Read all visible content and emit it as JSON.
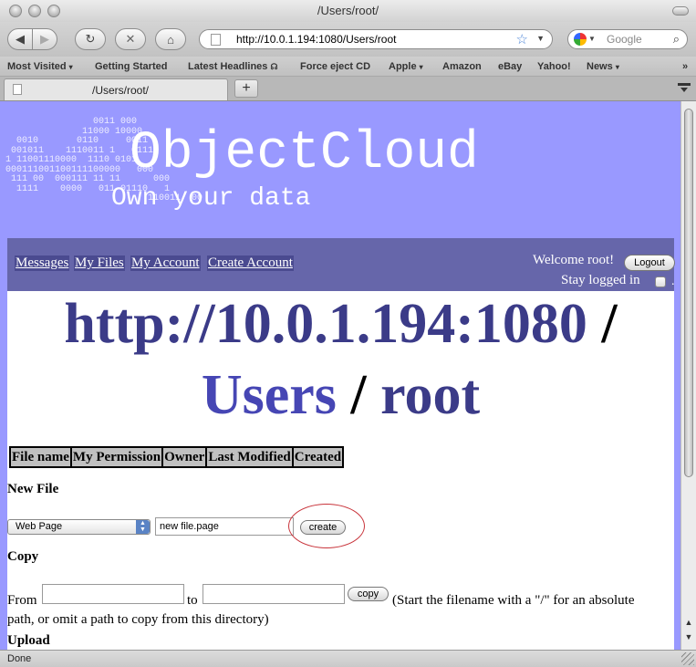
{
  "window": {
    "title": "/Users/root/"
  },
  "nav": {
    "url": "http://10.0.1.194:1080/Users/root",
    "search_placeholder": "Google"
  },
  "bookmarks": [
    "Most Visited",
    "Getting Started",
    "Latest Headlines",
    "Force eject CD",
    "Apple",
    "Amazon",
    "eBay",
    "Yahoo!",
    "News"
  ],
  "tabs": [
    {
      "label": "/Users/root/"
    }
  ],
  "header": {
    "title": "ObjectCloud",
    "tagline": "Own your data",
    "binary_art": "                 0011 000\n               11000 10000\n   0010       0110     0011\n  001011    1110011 1   0111\n 1 11001110000  1110 0101\n 000111001100111100000   000\n  111 00  000111 11 11      000\n   1111    0000   011 01110   1\n                           110011  00"
  },
  "menu": {
    "links": [
      "Messages",
      "My Files",
      "My Account",
      "Create Account"
    ],
    "welcome": "Welcome root!",
    "logout": "Logout",
    "stay_logged_in": "Stay logged in",
    "stay_suffix": "."
  },
  "breadcrumb": {
    "host": "http://10.0.1.194:1080",
    "sep": "/",
    "users": "Users",
    "current": "root"
  },
  "files_table": {
    "headers": [
      "File name",
      "My Permission",
      "Owner",
      "Last Modified",
      "Created"
    ]
  },
  "new_file": {
    "heading": "New File",
    "type_selected": "Web Page",
    "filename_value": "new file.page",
    "create_label": "create"
  },
  "copy": {
    "heading": "Copy",
    "from_label": "From",
    "to_label": "to",
    "button_label": "copy",
    "hint_line1": "(Start the filename with a \"/\" for an absolute",
    "hint_line2": "path, or omit a path to copy from this directory)"
  },
  "upload": {
    "heading": "Upload"
  },
  "status": {
    "text": "Done"
  }
}
